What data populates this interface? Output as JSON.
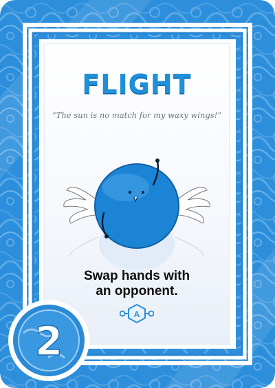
{
  "card": {
    "title": "FLIGHT",
    "quote": "“The sun is no match for my waxy wings!”",
    "ability_line1": "Swap hands with",
    "ability_line2": "an opponent.",
    "action_symbol": "A",
    "cost": "2",
    "character_icon": "winged-blue-ball",
    "colors": {
      "frame": "#2c8fdc",
      "title": "#1f8fd8",
      "character": "#1f86d6"
    }
  }
}
